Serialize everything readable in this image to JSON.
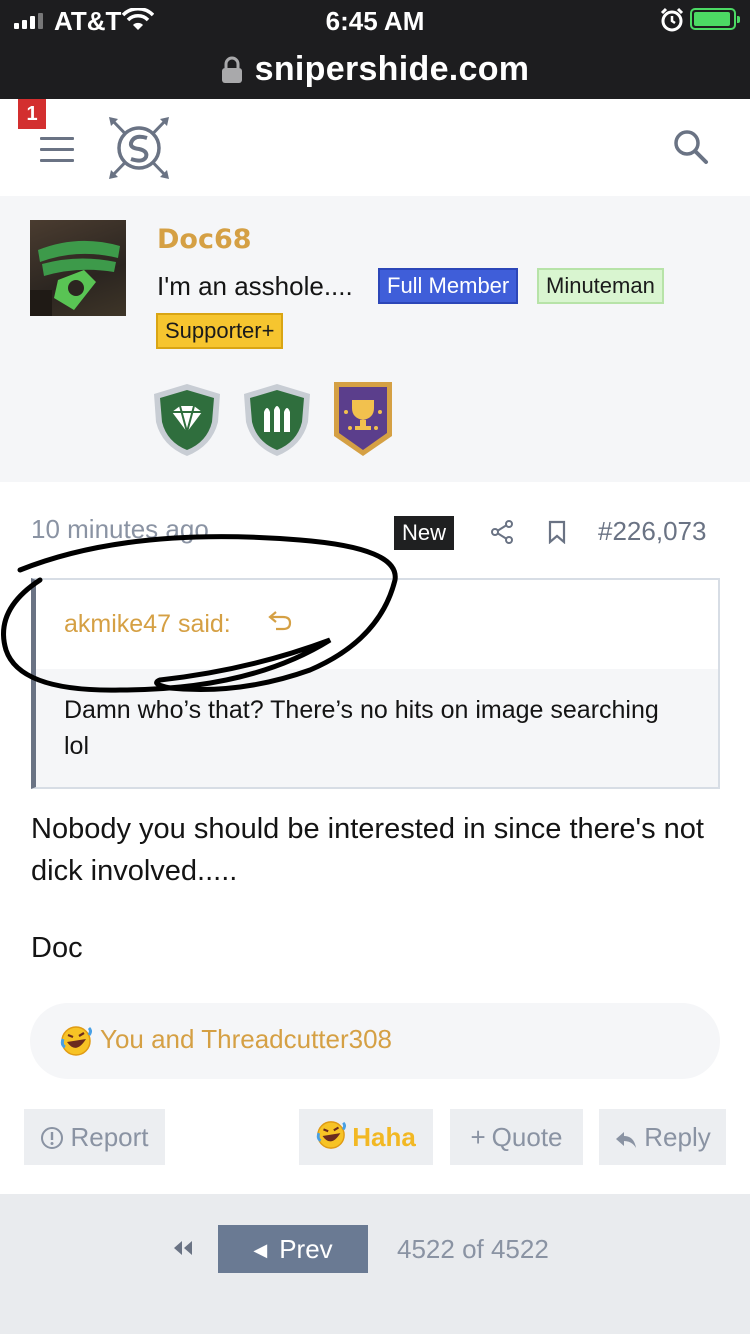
{
  "status_bar": {
    "carrier": "AT&T",
    "time": "6:45 AM"
  },
  "browser": {
    "url": "snipershide.com"
  },
  "header": {
    "notification_count": "1"
  },
  "user": {
    "name": "Doc68",
    "title": "I'm an asshole....",
    "banners": {
      "full_member": "Full Member",
      "minuteman": "Minuteman",
      "supporter": "Supporter+"
    }
  },
  "post": {
    "date": "10 minutes ago",
    "new_label": "New",
    "number": "#226,073",
    "quote": {
      "author": "akmike47 said:",
      "text": "Damn who’s that? There’s no hits on image searching lol"
    },
    "body": "Nobody you should be interested in since there's not dick involved.....",
    "signature": "Doc",
    "reactions": "You and Threadcutter308",
    "actions": {
      "report": "Report",
      "haha": "Haha",
      "quote": "Quote",
      "reply": "Reply"
    }
  },
  "pagination": {
    "prev": "Prev",
    "info": "4522 of 4522"
  }
}
